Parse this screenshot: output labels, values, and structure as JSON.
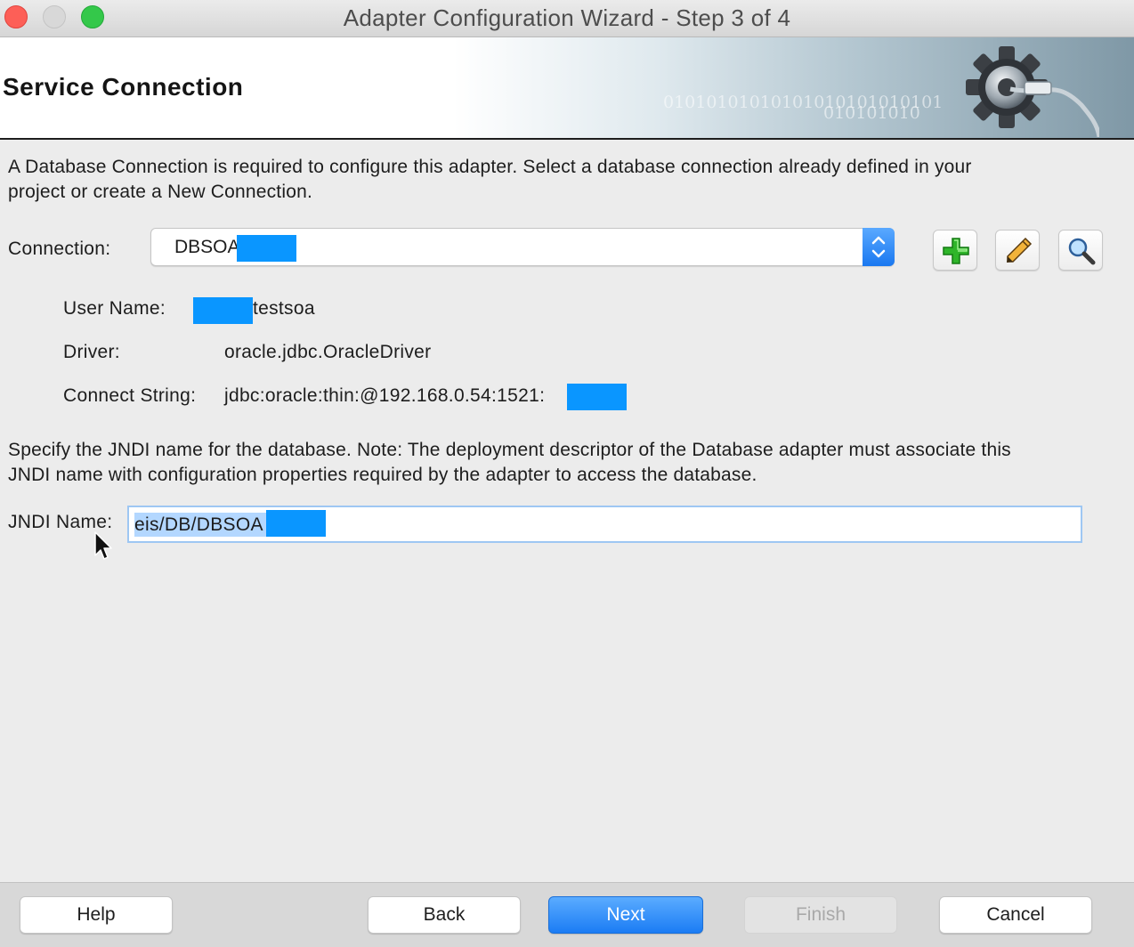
{
  "window": {
    "title": "Adapter Configuration Wizard - Step 3 of 4"
  },
  "header": {
    "title": "Service Connection",
    "binary_line1": "01010101010101010101010101",
    "binary_line2": "010101010"
  },
  "intro": {
    "line1": "A Database Connection is required to configure this adapter. Select a database connection already defined in your",
    "line2": "project or create a New Connection."
  },
  "connection": {
    "label": "Connection:",
    "value": "DBSOA"
  },
  "details": {
    "user_name_label": "User Name:",
    "user_name_value": "testsoa",
    "driver_label": "Driver:",
    "driver_value": "oracle.jdbc.OracleDriver",
    "connect_string_label": "Connect String:",
    "connect_string_value": "jdbc:oracle:thin:@192.168.0.54:1521:"
  },
  "jndi_note": {
    "line1": "Specify the JNDI name for the database.  Note: The deployment descriptor of the Database adapter must associate this",
    "line2": "JNDI name with configuration properties required by the adapter to access the database."
  },
  "jndi": {
    "label": "JNDI Name:",
    "value": "eis/DB/DBSOA"
  },
  "footer": {
    "help": "Help",
    "back": "Back",
    "next": "Next",
    "finish": "Finish",
    "cancel": "Cancel"
  },
  "icons": {
    "add": "plus-icon",
    "edit": "pencil-icon",
    "browse": "magnifier-icon"
  },
  "colors": {
    "accent": "#1b7cf4",
    "redaction": "#0a96ff",
    "selection": "#b3d7ff"
  }
}
